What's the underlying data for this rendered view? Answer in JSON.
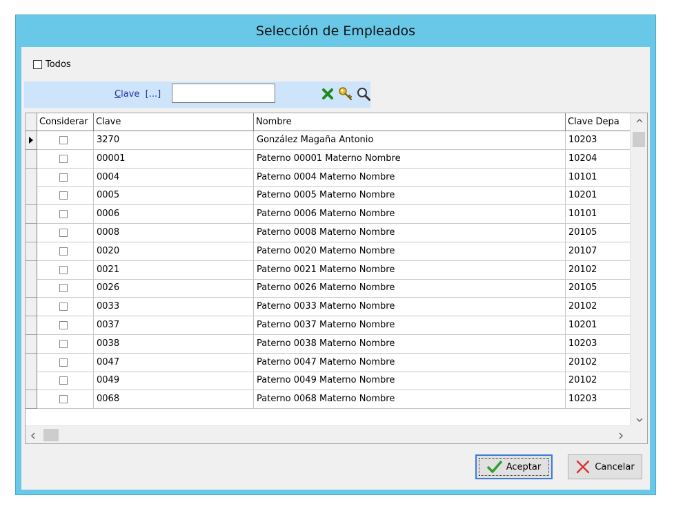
{
  "window": {
    "title": "Selección de Empleados"
  },
  "todos": {
    "label": "Todos",
    "checked": false
  },
  "search": {
    "label_u": "C",
    "label_rest": "lave",
    "label_suffix": "[...]",
    "value": "",
    "icons": [
      "clear-x-icon",
      "key-icon",
      "magnifier-icon"
    ]
  },
  "grid": {
    "columns": [
      "Considerar",
      "Clave",
      "Nombre",
      "Clave Depa"
    ],
    "rows": [
      {
        "clave": "3270",
        "nombre": "González Magaña Antonio",
        "depa": "10203"
      },
      {
        "clave": "00001",
        "nombre": "Paterno 00001 Materno  Nombre",
        "depa": "10204"
      },
      {
        "clave": "0004",
        "nombre": "Paterno 0004 Materno  Nombre",
        "depa": "10101"
      },
      {
        "clave": "0005",
        "nombre": "Paterno 0005 Materno  Nombre",
        "depa": "10201"
      },
      {
        "clave": "0006",
        "nombre": "Paterno 0006 Materno  Nombre",
        "depa": "10101"
      },
      {
        "clave": "0008",
        "nombre": "Paterno 0008 Materno  Nombre",
        "depa": "20105"
      },
      {
        "clave": "0020",
        "nombre": "Paterno 0020 Materno  Nombre",
        "depa": "20107"
      },
      {
        "clave": "0021",
        "nombre": "Paterno 0021 Materno  Nombre",
        "depa": "20102"
      },
      {
        "clave": "0026",
        "nombre": "Paterno 0026 Materno  Nombre",
        "depa": "20105"
      },
      {
        "clave": "0033",
        "nombre": "Paterno 0033 Materno  Nombre",
        "depa": "20102"
      },
      {
        "clave": "0037",
        "nombre": "Paterno 0037 Materno  Nombre",
        "depa": "10201"
      },
      {
        "clave": "0038",
        "nombre": "Paterno 0038 Materno  Nombre",
        "depa": "10203"
      },
      {
        "clave": "0047",
        "nombre": "Paterno 0047 Materno  Nombre",
        "depa": "20102"
      },
      {
        "clave": "0049",
        "nombre": "Paterno 0049 Materno  Nombre",
        "depa": "20102"
      },
      {
        "clave": "0068",
        "nombre": "Paterno 0068 Materno  Nombre",
        "depa": "10203"
      }
    ]
  },
  "buttons": {
    "accept": "Aceptar",
    "cancel": "Cancelar"
  },
  "colors": {
    "title_bar": "#69c8e8",
    "search_bar": "#cde4fb",
    "link_blue": "#1b2fa6",
    "accept_check": "#2e9e2e",
    "cancel_x": "#d83030"
  }
}
